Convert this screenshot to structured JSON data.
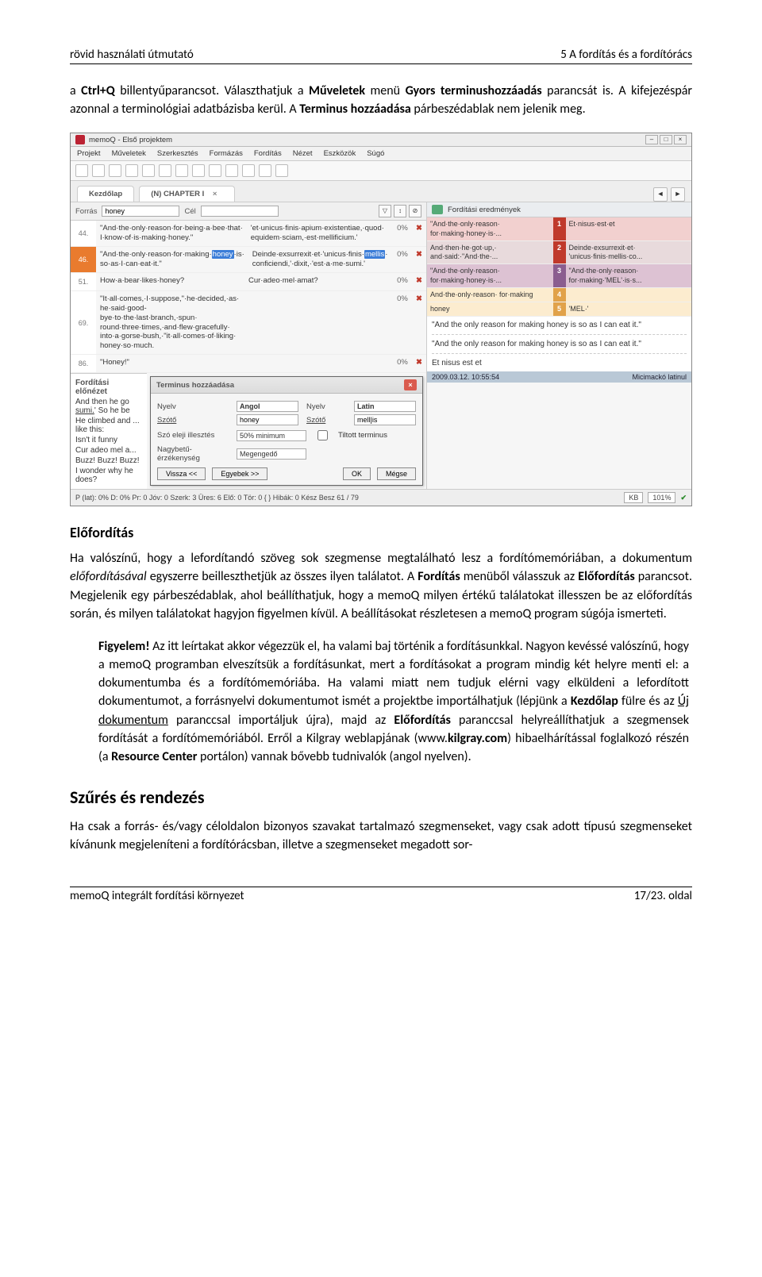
{
  "header": {
    "left": "rövid használati útmutató",
    "right": "5 A fordítás és a fordítórács"
  },
  "para1_before_bold1": "a ",
  "para1_bold1": "Ctrl+Q",
  "para1_mid1": " billentyűparancsot. Választhatjuk a ",
  "para1_bold2": "Műveletek",
  "para1_mid2": " menü ",
  "para1_bold3": "Gyors terminushozzáadás",
  "para1_mid3": " parancsát is. A kifejezéspár azonnal a terminológiai adatbázisba kerül. A ",
  "para1_bold4": "Terminus hozzáadása",
  "para1_end": " párbeszédablak nem jelenik meg.",
  "shot": {
    "title": "memoQ - Első projektem",
    "menus": [
      "Projekt",
      "Műveletek",
      "Szerkesztés",
      "Formázás",
      "Fordítás",
      "Nézet",
      "Eszközök",
      "Súgó"
    ],
    "tabs": {
      "home": "Kezdőlap",
      "doc": "(N) CHAPTER I"
    },
    "forras_label": "Forrás",
    "forras_value": "honey",
    "cel_label": "Cél",
    "tm_header": "Fordítási eredmények",
    "gridrows": [
      {
        "n": "44.",
        "cls": "rn-gray",
        "src": "\"And·the·only·reason·for·being·a·bee·that· I·know·of·is·making·honey.\"",
        "tgt": "'et·unicus·finis·apium·existentiae,·quod· equidem·sciam,·est·mellificium.'",
        "pct": "0%"
      },
      {
        "n": "46.",
        "cls": "rn-orange",
        "src": "\"And·the·only·reason·for·making·[honey]·is· so·as·I·can·eat·it.\"",
        "tgt": "Deinde·exsurrexit·et·'unicus·finis·[mellis] conficiendi,'·dixit,·'est·a·me·sumi.'",
        "pct": "0%"
      },
      {
        "n": "51.",
        "cls": "rn-gray",
        "src": "How·a·bear·likes·honey?",
        "tgt": "Cur·adeo·mel·amat?",
        "pct": "0%"
      },
      {
        "n": "69.",
        "cls": "rn-gray",
        "src": "\"It·all·comes,·I·suppose,\"·he·decided,·as· he·said·good-bye·to·the·last·branch,·spun· round·three·times,·and·flew·gracefully· into·a·gorse-bush,·\"it·all·comes·of·liking· honey·so·much.",
        "tgt": "",
        "pct": "0%"
      },
      {
        "n": "86.",
        "cls": "rn-gray",
        "src": "\"Honey!\"",
        "tgt": "",
        "pct": "0%"
      }
    ],
    "preview_label": "Fordítási előnézet",
    "preview_lines": [
      "And then he go ... sumi.' So he be ...",
      "He climbed and ... like this:",
      "Isn't it funny",
      "Cur adeo mel a...",
      "Buzz! Buzz! Buzz!",
      "I wonder why he does?"
    ],
    "dialog": {
      "title": "Terminus hozzáadása",
      "nyelv1_label": "Nyelv",
      "nyelv1_value": "Angol",
      "nyelv2_label": "Nyelv",
      "nyelv2_value": "Latin",
      "szoto1_label": "Szótő",
      "szoto1_value": "honey",
      "szoto2_label": "Szótő",
      "szoto2_value": "mell|is",
      "adj_label": "Szó eleji illesztés",
      "adj_value": "50% minimum",
      "forbid_label": "Tiltott terminus",
      "case_label": "Nagybetű-érzékenység",
      "case_value": "Megengedő",
      "vissza": "Vissza <<",
      "egyebek": "Egyebek >>",
      "ok": "OK",
      "megse": "Mégse"
    },
    "tm_hits": [
      {
        "src": "\"And·the·only·reason· for·making·honey·is·...",
        "tgt": "Et·nisus·est·et",
        "num": "1",
        "rowcls": "hit1",
        "numcls": "tm-bg-red"
      },
      {
        "src": "And·then·he·got·up,· and·said:·\"And·the·...",
        "tgt": "Deinde·exsurrexit·et· 'unicus·finis·mellis·co...",
        "num": "2",
        "rowcls": "hit2",
        "numcls": "tm-bg-red"
      },
      {
        "src": "\"And·the·only·reason· for·making·honey·is·...",
        "tgt": "\"And·the·only·reason· for·making·'MEL'·is·s...",
        "num": "3",
        "rowcls": "hit3",
        "numcls": "tm-bg-purple"
      },
      {
        "src": "And·the·only·reason· for·making",
        "tgt": "",
        "num": "4",
        "rowcls": "hit4",
        "numcls": "tm-bg-orange"
      },
      {
        "src": "honey",
        "tgt": "'MEL·'",
        "num": "5",
        "rowcls": "hit4",
        "numcls": "tm-bg-orange"
      }
    ],
    "below_right1": "\"And the only reason for making honey is so as I can eat it.\"",
    "below_right2": "\"And the only reason for making honey is so as I can eat it.\"",
    "below_right3": "Et nisus est et",
    "meta_time": "2009.03.12. 10:55:54",
    "meta_user": "Micimackó latinul",
    "status": "P (lat): 0%  D: 0%    Pr: 0    Jóv: 0    Szerk: 3    Üres: 6    Elő: 0    Tör: 0  { }  Hibák: 0    Kész    Besz    61 / 79",
    "kb": "KB",
    "pct": "101%"
  },
  "h2_eloforditas": "Előfordítás",
  "para2_a": "Ha valószínű, hogy a lefordítandó szöveg sok szegmense megtalálható lesz a fordítómemóriában, a dokumentum ",
  "para2_em": "előfordításával",
  "para2_b": " egyszerre beilleszthetjük az összes ilyen találatot. A ",
  "para2_bold1": "Fordítás",
  "para2_c": " menüből válasszuk az ",
  "para2_bold2": "Előfordítás",
  "para2_d": " parancsot. Megjelenik egy párbeszédablak, ahol beállíthatjuk, hogy a memoQ milyen értékű találatokat illesszen be az előfordítás során, és milyen találatokat hagyjon figyelmen kívül. A beállításokat részletesen a memoQ program súgója ismerteti.",
  "para3_bold_lead": "Figyelem!",
  "para3_a": " Az itt leírtakat akkor végezzük el, ha valami baj történik a fordításunkkal. Nagyon kevéssé valószínű, hogy a memoQ programban elveszítsük a fordításunkat, mert a fordításokat a program mindig két helyre menti el: a dokumentumba és a fordítómemóriába. Ha valami miatt nem tudjuk elérni vagy elküldeni a lefordított dokumentumot, a forrásnyelvi dokumentumot ismét a projektbe importálhatjuk (lépjünk a ",
  "para3_bold1": "Kezdőlap",
  "para3_b": " fülre és az ",
  "para3_u": "Új dokumentum",
  "para3_c": " paranccsal importáljuk újra), majd az ",
  "para3_bold2": "Előfordítás",
  "para3_d": " paranccsal helyreállíthatjuk a szegmensek fordítását a fordítómemóriából. Erről a Kilgray weblapjának (",
  "para3_sans1": "www.",
  "para3_bold_sans": "kilgray.com",
  "para3_e": ") hibaelhárítással foglalkozó részén (a ",
  "para3_bold3": "Resource Center",
  "para3_f": " portálon) vannak bővebb tudnivalók (angol nyelven).",
  "h2_szures": "Szűrés és rendezés",
  "para4": "Ha csak a forrás- és/vagy céloldalon bizonyos szavakat tartalmazó szegmenseket, vagy csak adott típusú szegmenseket kívánunk megjeleníteni a fordítórácsban, illetve a szegmenseket megadott sor-",
  "footer": {
    "left": "memoQ integrált fordítási környezet",
    "right": "17/23. oldal"
  }
}
